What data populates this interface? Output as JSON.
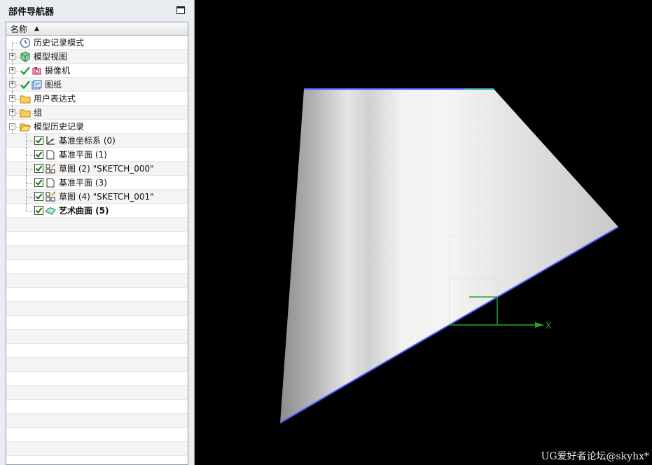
{
  "navigator": {
    "title": "部件导航器",
    "column_header": "名称",
    "items": [
      {
        "label": "历史记录模式",
        "icon": "clock-icon",
        "level": 0
      },
      {
        "label": "模型视图",
        "icon": "model-view-icon",
        "level": 0,
        "expander": "+"
      },
      {
        "label": "摄像机",
        "icon": "camera-icon",
        "level": 0,
        "expander": "+",
        "checked": true
      },
      {
        "label": "图纸",
        "icon": "drawing-sheet-icon",
        "level": 0,
        "expander": "+",
        "checked": true
      },
      {
        "label": "用户表达式",
        "icon": "folder-icon",
        "level": 0,
        "expander": "+"
      },
      {
        "label": "组",
        "icon": "folder-icon",
        "level": 0,
        "expander": "+"
      },
      {
        "label": "模型历史记录",
        "icon": "folder-open-icon",
        "level": 0,
        "expander": "-"
      },
      {
        "label": "基准坐标系 (0)",
        "icon": "datum-csys-icon",
        "level": 1,
        "checkbox": true
      },
      {
        "label": "基准平面 (1)",
        "icon": "datum-plane-icon",
        "level": 1,
        "checkbox": true
      },
      {
        "label": "草图 (2) \"SKETCH_000\"",
        "icon": "sketch-icon",
        "level": 1,
        "checkbox": true
      },
      {
        "label": "基准平面 (3)",
        "icon": "datum-plane-icon",
        "level": 1,
        "checkbox": true
      },
      {
        "label": "草图 (4) \"SKETCH_001\"",
        "icon": "sketch-icon",
        "level": 1,
        "checkbox": true
      },
      {
        "label": "艺术曲面 (5)",
        "icon": "studio-surface-icon",
        "level": 1,
        "checkbox": true,
        "bold": true
      }
    ]
  },
  "viewport": {
    "axis_label": "X",
    "watermark": "UG爱好者论坛@skyhx*",
    "background_color": "#000000",
    "edge_color": "#4a5cff",
    "axis_color": "#1fa52a"
  }
}
